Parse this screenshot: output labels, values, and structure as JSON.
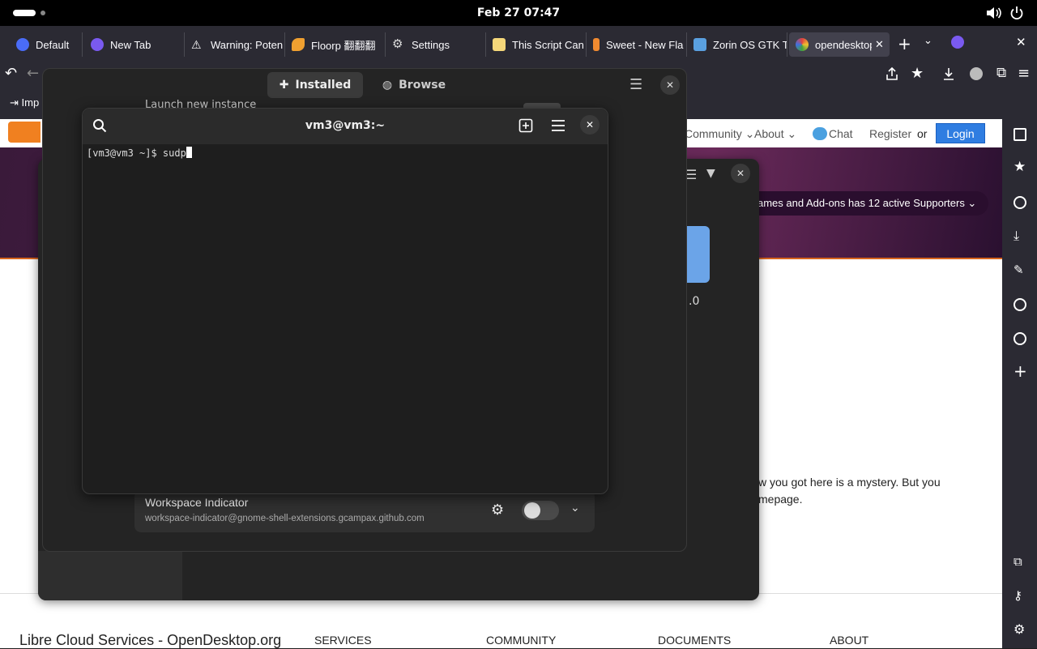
{
  "topbar": {
    "clock": "Feb 27  07:47"
  },
  "browser": {
    "tabs": [
      {
        "label": "Default",
        "icon": "firefox-view-icon",
        "color": "#4a6cf7"
      },
      {
        "label": "New Tab",
        "icon": "floorp-icon",
        "color": "#7a5af0"
      },
      {
        "label": "Warning: Poten",
        "icon": "warning-icon",
        "color": "#ffffff"
      },
      {
        "label": "Floorp 翻翻翻",
        "icon": "floorp-leaf-icon",
        "color": "#f0a030"
      },
      {
        "label": "Settings",
        "icon": "gear-icon",
        "color": "#cccccc"
      },
      {
        "label": "This Script Can",
        "icon": "script-icon",
        "color": "#f5d77a"
      },
      {
        "label": "Sweet - New Fla",
        "icon": "brush-icon",
        "color": "#f08a30"
      },
      {
        "label": "Zorin OS GTK Th",
        "icon": "zorin-icon",
        "color": "#5aa0e0"
      },
      {
        "label": "opendesktop",
        "icon": "opendesktop-icon",
        "color": "#e04040"
      }
    ],
    "bookmark_import": "Imp"
  },
  "website": {
    "nav": {
      "community": "Community ⌄",
      "about": "About ⌄",
      "chat": "Chat",
      "register": "Register",
      "or": "or",
      "login": "Login"
    },
    "supporters": "ames and Add-ons has 12 active Supporters ⌄",
    "version_fragment": ".0",
    "mystery_line1": "w you got here is a mystery. But you",
    "mystery_line2": "mepage.",
    "footer": {
      "brand": "Libre Cloud Services - OpenDesktop.org",
      "services": "SERVICES",
      "community": "COMMUNITY",
      "documents": "DOCUMENTS",
      "about": "ABOUT"
    }
  },
  "extensions_app": {
    "installed_tab": "Installed",
    "browse_tab": "Browse",
    "partial_row": "Launch new instance",
    "row": {
      "name": "Workspace Indicator",
      "uuid": "workspace-indicator@gnome-shell-extensions.gcampax.github.com"
    }
  },
  "terminal": {
    "title": "vm3@vm3:~",
    "prompt": "[vm3@vm3 ~]$ ",
    "input": "sudp"
  }
}
